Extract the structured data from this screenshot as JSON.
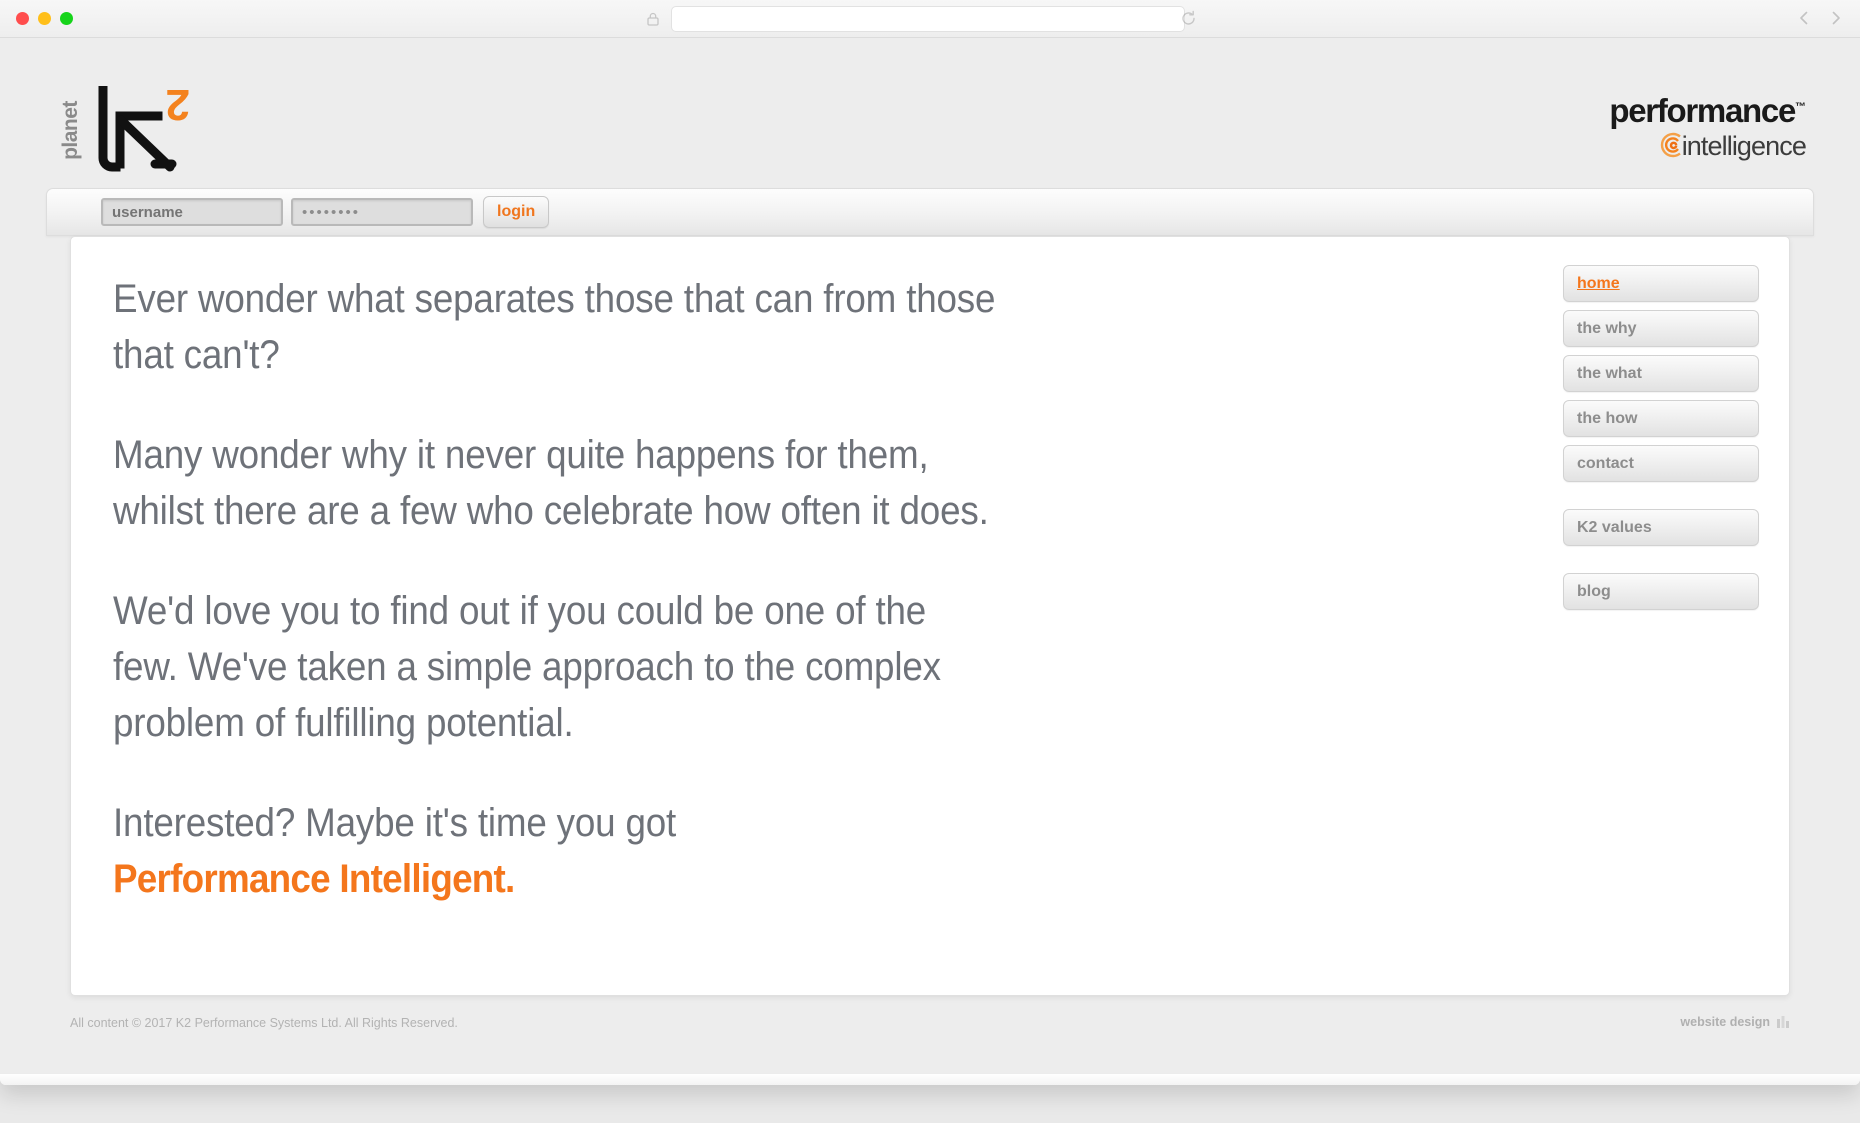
{
  "browser": {
    "url_value": "",
    "url_placeholder": "",
    "lock_icon": "lock-icon",
    "reload_icon": "reload-icon",
    "back_icon": "chevron-left-icon",
    "forward_icon": "chevron-right-icon",
    "traffic_lights": [
      "close",
      "minimize",
      "zoom"
    ]
  },
  "header": {
    "brand_left": {
      "word": "planet",
      "mark_letter": "k",
      "mark_exponent": "2",
      "icon": "k2-cursor-logo"
    },
    "brand_right": {
      "line1": "performance",
      "trademark": "™",
      "line2": "intelligence",
      "icon": "concentric-arc-icon"
    }
  },
  "login": {
    "username_value": "",
    "username_placeholder": "username",
    "password_value": "••••••••",
    "password_placeholder": "",
    "button_label": "login"
  },
  "main": {
    "paragraphs": [
      "Ever wonder what separates those that can from those that can't?",
      "Many wonder why it never quite happens for them, whilst there are a few who celebrate how often it does.",
      "We'd love you to find out if you could be one of the few. We've taken a simple approach to the complex problem of fulfilling potential.",
      "Interested? Maybe it's time you got"
    ],
    "accent_line": "Performance Intelligent."
  },
  "nav": {
    "items": [
      {
        "label": "home",
        "active": true,
        "gap_above": false
      },
      {
        "label": "the why",
        "active": false,
        "gap_above": false
      },
      {
        "label": "the what",
        "active": false,
        "gap_above": false
      },
      {
        "label": "the how",
        "active": false,
        "gap_above": false
      },
      {
        "label": "contact",
        "active": false,
        "gap_above": false
      },
      {
        "label": "K2 values",
        "active": false,
        "gap_above": true
      },
      {
        "label": "blog",
        "active": false,
        "gap_above": true
      }
    ]
  },
  "footer": {
    "copyright": "All content © 2017 K2 Performance Systems Ltd. All Rights Reserved.",
    "credit_label": "website design",
    "credit_icon": "designer-badge-icon"
  },
  "colors": {
    "accent_orange": "#f4761c",
    "body_gray": "#6e7279",
    "page_bg": "#ededed",
    "panel_bg": "#ffffff",
    "nav_text": "#8d8d8d"
  }
}
